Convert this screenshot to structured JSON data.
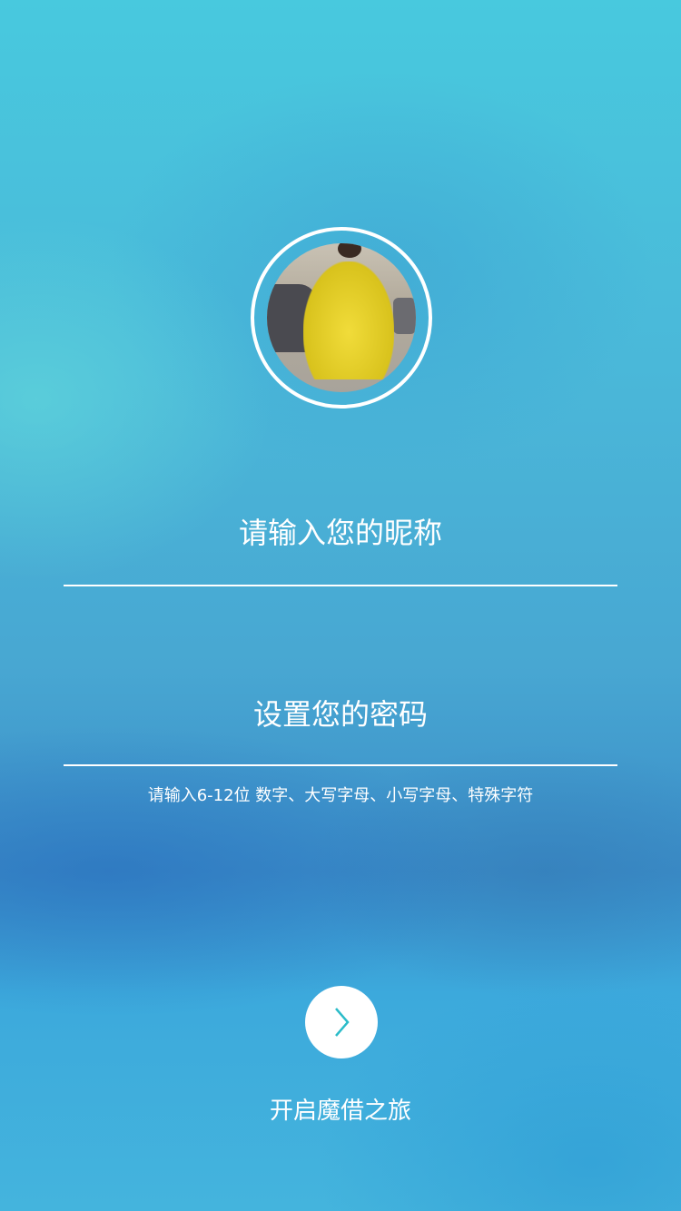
{
  "avatar": {
    "alt": "profile photo"
  },
  "nickname": {
    "placeholder": "请输入您的昵称"
  },
  "password": {
    "placeholder": "设置您的密码",
    "hint": "请输入6-12位 数字、大写字母、小写字母、特殊字符"
  },
  "start": {
    "icon": "chevron-right-icon",
    "label": "开启魔借之旅",
    "accent": "#2bbcc9"
  }
}
